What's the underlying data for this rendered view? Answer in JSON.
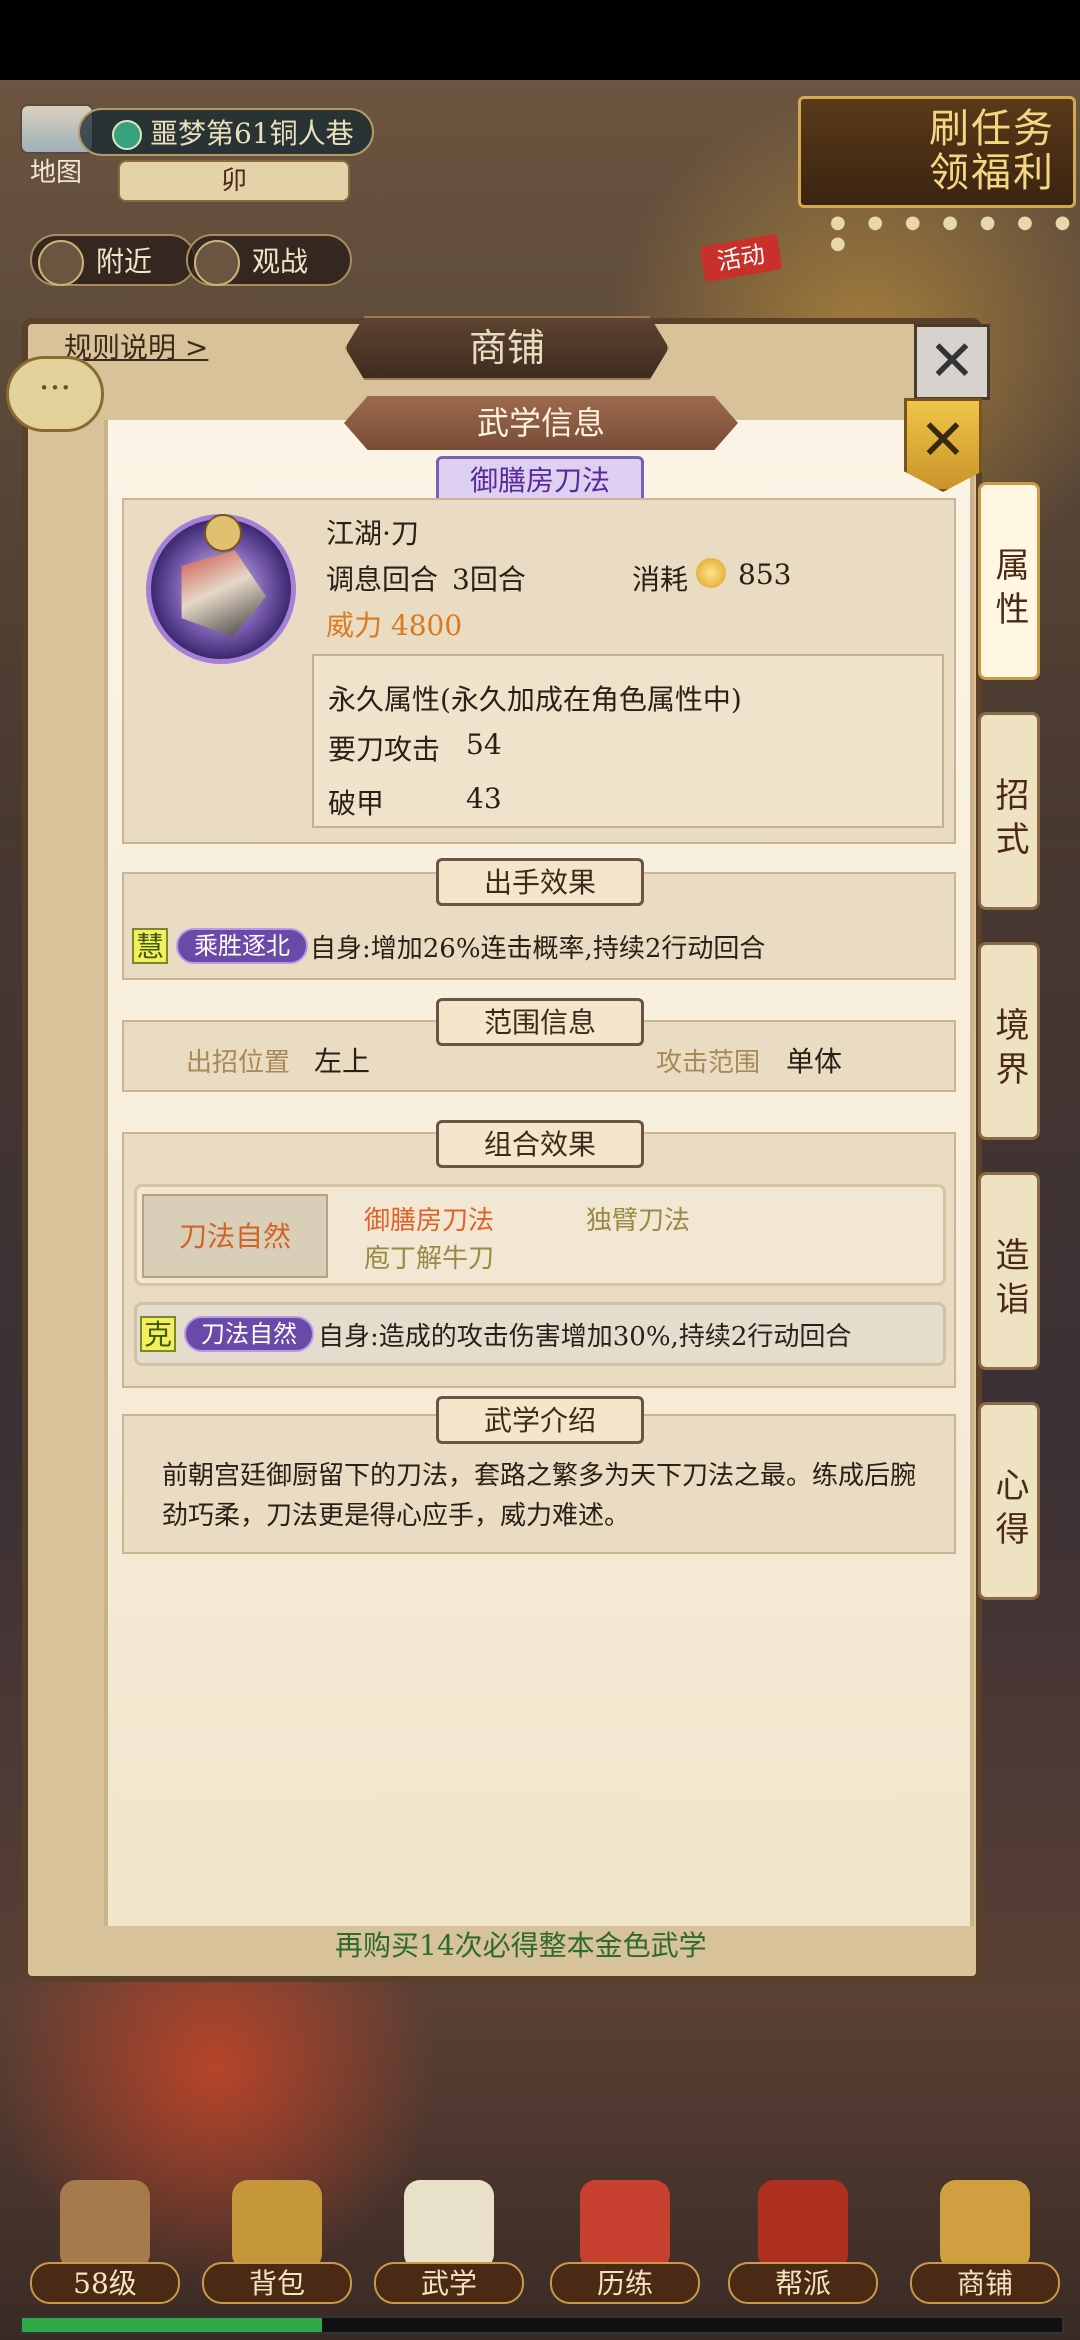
{
  "top": {
    "map_label": "地图",
    "location": "噩梦第61铜人巷",
    "time": "卯",
    "nearby": "附近",
    "spectate": "观战",
    "quest_banner_line1": "刷任务",
    "quest_banner_line2": "领福利",
    "activity_tag": "活动"
  },
  "shop": {
    "title": "商铺",
    "rules_link": "规则说明 >",
    "footer_text": "再购买14次必得整本金色武学"
  },
  "modal": {
    "title": "武学信息",
    "skill_name": "御膳房刀法",
    "category": "江湖·刀",
    "cooldown_label": "调息回合",
    "cooldown_value": "3回合",
    "cost_label": "消耗",
    "cost_value": "853",
    "power": "威力 4800",
    "attr_title": "永久属性(永久加成在角色属性中)",
    "attrs": [
      {
        "name": "要刀攻击",
        "value": "54"
      },
      {
        "name": "破甲",
        "value": "43"
      }
    ],
    "sec_effect": "出手效果",
    "effect_tag": "慧",
    "effect_name": "乘胜逐北",
    "effect_desc": "自身:增加26%连击概率,持续2行动回合",
    "sec_range": "范围信息",
    "pos_label": "出招位置",
    "pos_value": "左上",
    "range_label": "攻击范围",
    "range_value": "单体",
    "sec_combo": "组合效果",
    "combo_name": "刀法自然",
    "combo_members": [
      "御膳房刀法",
      "独臂刀法",
      "庖丁解牛刀"
    ],
    "combo_tag": "克",
    "combo_effect_name": "刀法自然",
    "combo_desc": "自身:造成的攻击伤害增加30%,持续2行动回合",
    "sec_intro": "武学介绍",
    "intro": "前朝宫廷御厨留下的刀法，套路之繁多为天下刀法之最。练成后腕劲巧柔，刀法更是得心应手，威力难述。"
  },
  "side_tabs": [
    "属性",
    "招式",
    "境界",
    "造诣",
    "心得"
  ],
  "bottom_nav": [
    "58级",
    "背包",
    "武学",
    "历练",
    "帮派",
    "商铺"
  ],
  "xp_progress": 0.29,
  "colors": {
    "power": "#d97a22",
    "combo_active": "#d06326",
    "tag_purple": "#6a4aa8"
  }
}
